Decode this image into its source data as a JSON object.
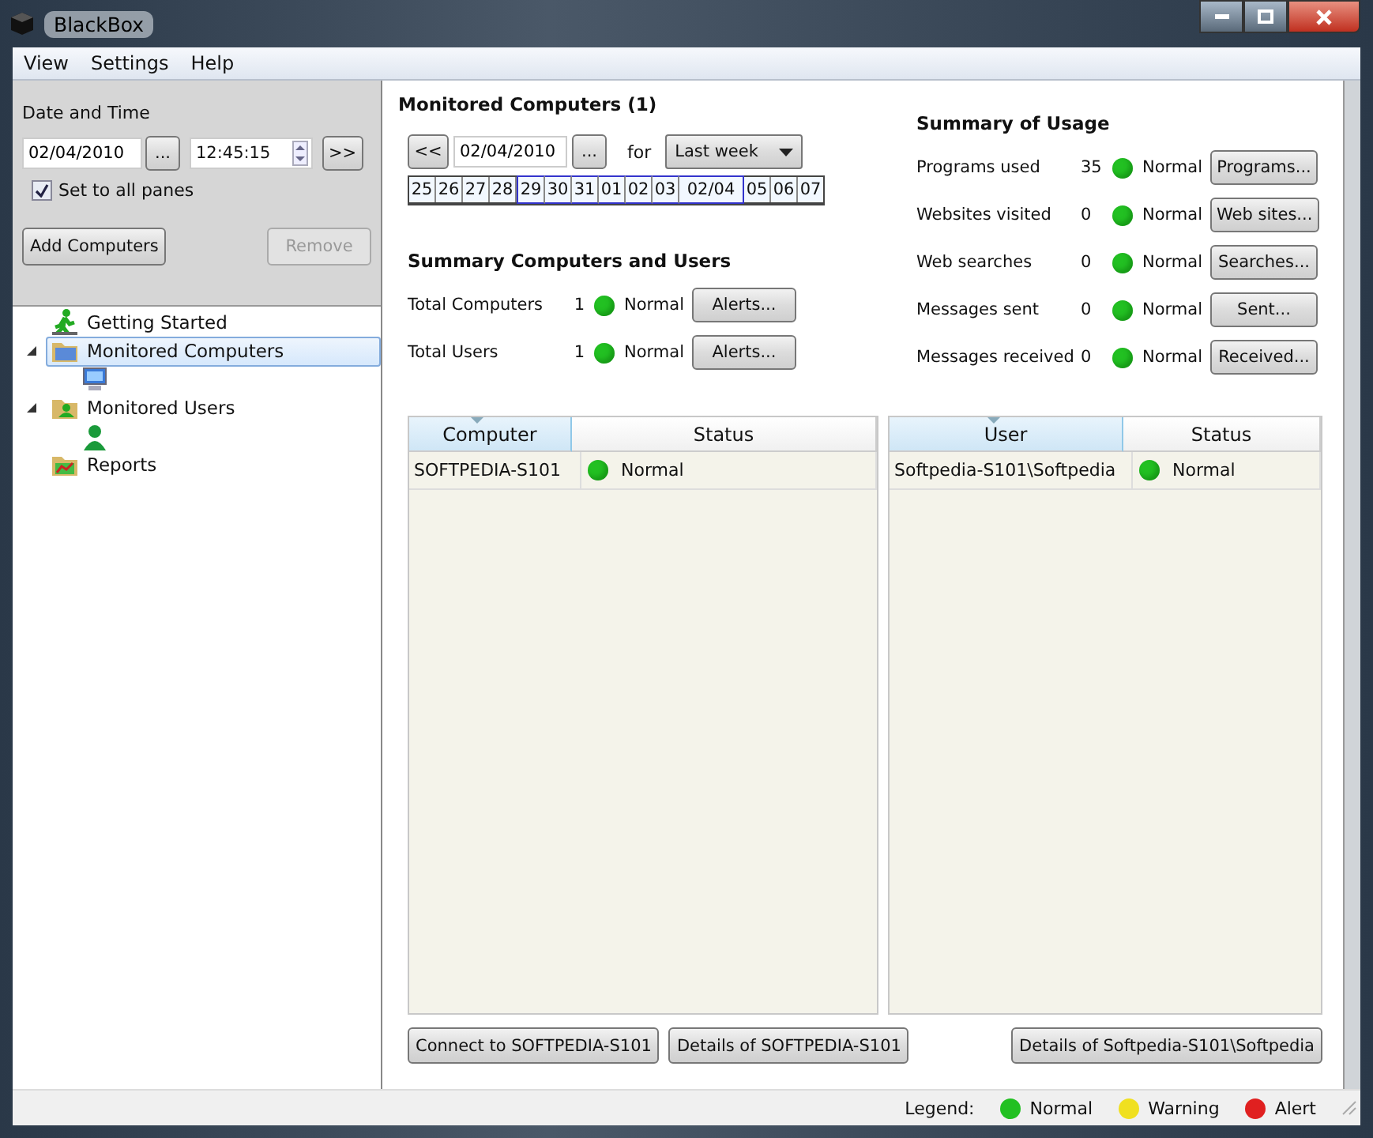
{
  "window": {
    "title": "BlackBox"
  },
  "menu": [
    "View",
    "Settings",
    "Help"
  ],
  "date_time": {
    "label": "Date and Time",
    "date": "02/04/2010",
    "date_button": "...",
    "time": "12:45:15",
    "next_button": ">>",
    "set_all": {
      "label": "Set to all panes",
      "checked": true
    }
  },
  "left_buttons": [
    {
      "label": "Add Computers",
      "disabled": false
    },
    {
      "label": "Remove",
      "disabled": true
    }
  ],
  "tree": [
    {
      "label": "Getting Started",
      "kind": "start",
      "selected": false
    },
    {
      "label": "Monitored Computers",
      "kind": "computers",
      "selected": true,
      "expanded": true,
      "children": [
        {
          "kind": "computer"
        }
      ]
    },
    {
      "label": "Monitored Users",
      "kind": "users",
      "selected": false,
      "expanded": true,
      "children": [
        {
          "kind": "user"
        }
      ]
    },
    {
      "label": "Reports",
      "kind": "reports",
      "selected": false
    }
  ],
  "heading": "Monitored Computers (1)",
  "period": {
    "prev_button": "<<",
    "date": "02/04/2010",
    "date_button": "...",
    "for_label": "for",
    "range": "Last week"
  },
  "days": [
    {
      "label": "25",
      "in_range": false
    },
    {
      "label": "26",
      "in_range": false
    },
    {
      "label": "27",
      "in_range": false
    },
    {
      "label": "28",
      "in_range": false
    },
    {
      "label": "29",
      "in_range": true
    },
    {
      "label": "30",
      "in_range": true
    },
    {
      "label": "31",
      "in_range": true
    },
    {
      "label": "01",
      "in_range": true
    },
    {
      "label": "02",
      "in_range": true
    },
    {
      "label": "03",
      "in_range": true
    },
    {
      "label": "02/04",
      "in_range": true
    },
    {
      "label": "05",
      "in_range": false
    },
    {
      "label": "06",
      "in_range": false
    },
    {
      "label": "07",
      "in_range": false
    }
  ],
  "summary_cu": {
    "title": "Summary Computers and Users",
    "rows": [
      {
        "label": "Total Computers",
        "count": "1",
        "color": "#22c022",
        "status_text": "Normal",
        "button": "Alerts..."
      },
      {
        "label": "Total Users",
        "count": "1",
        "color": "#22c022",
        "status_text": "Normal",
        "button": "Alerts..."
      }
    ]
  },
  "summary_usage": {
    "title": "Summary of Usage",
    "rows": [
      {
        "label": "Programs used",
        "count": "35",
        "color": "#22c022",
        "status_text": "Normal",
        "button": "Programs..."
      },
      {
        "label": "Websites visited",
        "count": "0",
        "color": "#22c022",
        "status_text": "Normal",
        "button": "Web sites..."
      },
      {
        "label": "Web searches",
        "count": "0",
        "color": "#22c022",
        "status_text": "Normal",
        "button": "Searches..."
      },
      {
        "label": "Messages sent",
        "count": "0",
        "color": "#22c022",
        "status_text": "Normal",
        "button": "Sent..."
      },
      {
        "label": "Messages received",
        "count": "0",
        "color": "#22c022",
        "status_text": "Normal",
        "button": "Received..."
      }
    ]
  },
  "tables": [
    {
      "columns": [
        "Computer",
        "Status"
      ],
      "rows": [
        {
          "name": "SOFTPEDIA-S101",
          "color": "#22c022",
          "status_text": "Normal"
        }
      ],
      "buttons": [
        "Connect to SOFTPEDIA-S101",
        "Details of SOFTPEDIA-S101"
      ]
    },
    {
      "columns": [
        "User",
        "Status"
      ],
      "rows": [
        {
          "name": "Softpedia-S101\\Softpedia",
          "color": "#22c022",
          "status_text": "Normal"
        }
      ],
      "buttons": [
        "Details of Softpedia-S101\\Softpedia"
      ]
    }
  ],
  "status_bar": {
    "legend_label": "Legend:",
    "items": [
      {
        "label": "Normal",
        "color": "#22c022"
      },
      {
        "label": "Warning",
        "color": "#f0e020"
      },
      {
        "label": "Alert",
        "color": "#e02020"
      }
    ]
  }
}
